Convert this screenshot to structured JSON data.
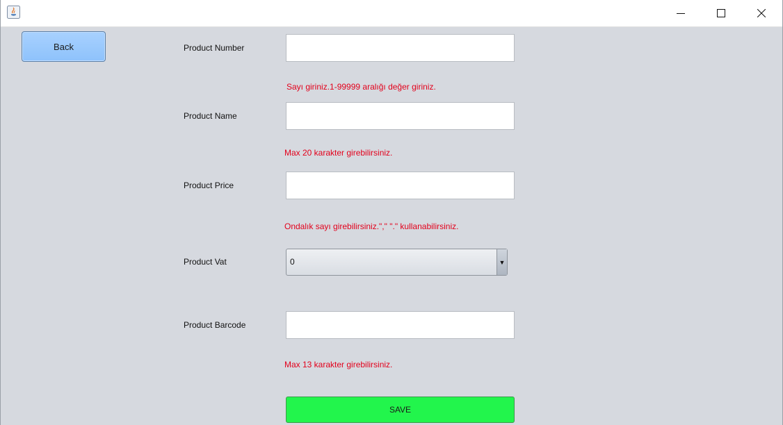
{
  "window": {
    "app_icon": "java-icon",
    "controls": {
      "minimize_icon": "minimize-icon",
      "maximize_icon": "maximize-icon",
      "close_icon": "close-icon"
    }
  },
  "back_button": {
    "label": "Back"
  },
  "form": {
    "product_number": {
      "label": "Product Number",
      "value": "",
      "hint": "Sayı giriniz.1-99999 aralığı değer giriniz."
    },
    "product_name": {
      "label": "Product Name",
      "value": "",
      "hint": "Max 20 karakter girebilirsiniz."
    },
    "product_price": {
      "label": "Product Price",
      "value": "",
      "hint": "Ondalık sayı girebilirsiniz.\",\" \".\" kullanabilirsiniz."
    },
    "product_vat": {
      "label": "Product Vat",
      "selected": "0",
      "arrow": "▼"
    },
    "product_barcode": {
      "label": "Product Barcode",
      "value": "",
      "hint": "Max 13 karakter girebilirsiniz."
    }
  },
  "save_button": {
    "label": "SAVE"
  },
  "colors": {
    "background": "#d6d9df",
    "hint_text": "#e3001b",
    "back_button": "#95c6fd",
    "save_button": "#22f54c"
  }
}
